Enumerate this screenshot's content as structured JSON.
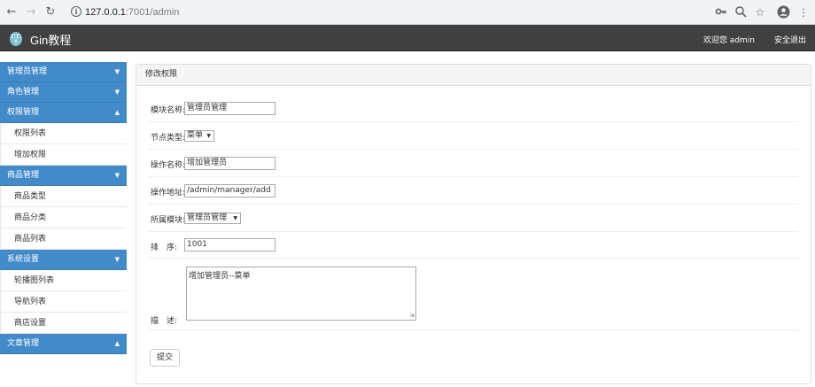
{
  "browser": {
    "url_host": "127.0.0.1",
    "url_rest": ":7001/admin",
    "back_icon": "arrow-left",
    "forward_icon": "arrow-right",
    "reload_icon": "reload"
  },
  "header": {
    "brand": "Gin教程",
    "welcome": "欢迎您 admin",
    "logout": "安全退出"
  },
  "sidebar": {
    "groups": [
      {
        "label": "管理员管理",
        "caret": "▼"
      },
      {
        "label": "角色管理",
        "caret": "▼"
      },
      {
        "label": "权限管理",
        "caret": "▲",
        "items": [
          "权限列表",
          "增加权限"
        ]
      },
      {
        "label": "商品管理",
        "caret": "▼",
        "items": [
          "商品类型",
          "商品分类",
          "商品列表"
        ]
      },
      {
        "label": "系统设置",
        "caret": "▼",
        "items": [
          "轮播图列表",
          "导航列表",
          "商店设置"
        ]
      },
      {
        "label": "文章管理",
        "caret": "▲"
      }
    ]
  },
  "panel": {
    "title": "修改权限",
    "fields": {
      "module_name": {
        "label": "模块名称:",
        "value": "管理员管理"
      },
      "node_type": {
        "label": "节点类型:",
        "value": "菜单"
      },
      "action_name": {
        "label": "操作名称:",
        "value": "增加管理员"
      },
      "action_url": {
        "label": "操作地址:",
        "value": "/admin/manager/add"
      },
      "parent_module": {
        "label": "所属模块:",
        "value": "管理员管理"
      },
      "sort": {
        "label": "排　序:",
        "value": "1001"
      },
      "description": {
        "label": "描　述:",
        "value": "增加管理员--菜单"
      }
    },
    "submit": "提交"
  }
}
